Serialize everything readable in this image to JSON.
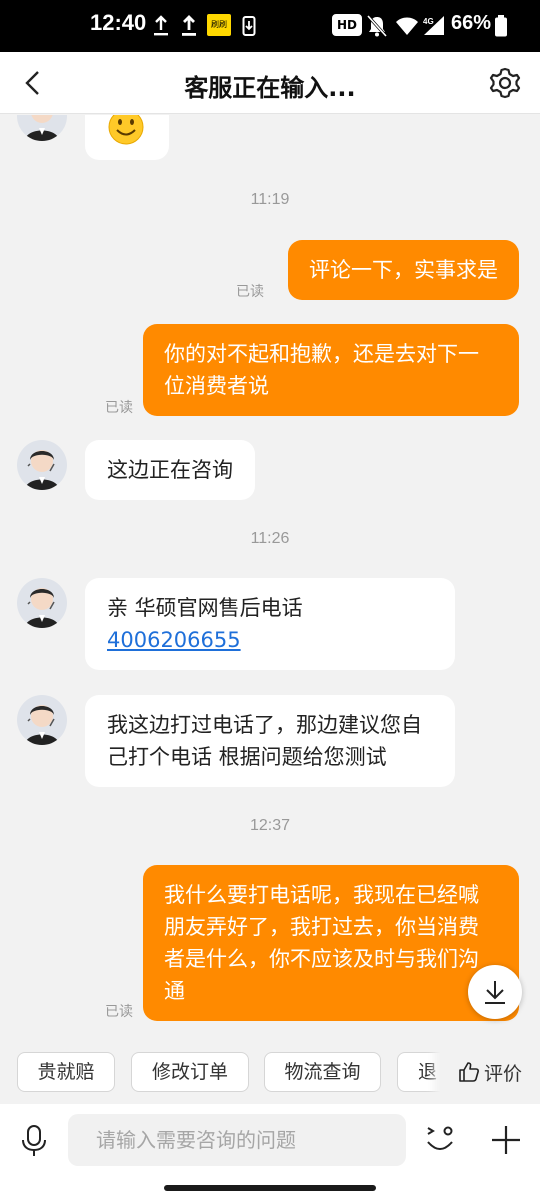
{
  "status_bar": {
    "time": "12:40",
    "hd": "HD",
    "network": "4G",
    "badge": "刷刷",
    "battery": "66%"
  },
  "header": {
    "title": "客服正在输入..."
  },
  "messages": {
    "ts_1": "11:19",
    "out_1": "评论一下，实事求是",
    "out_1_status": "已读",
    "out_2": "你的对不起和抱歉，还是去对下一位消费者说",
    "out_2_status": "已读",
    "in_1": "这边正在咨询",
    "ts_2": "11:26",
    "in_2_text": "亲 华硕官网售后电话",
    "in_2_phone": "4006206655",
    "in_3": "我这边打过电话了，那边建议您自己打个电话 根据问题给您测试",
    "ts_3": "12:37",
    "out_3": "我什么要打电话呢，我现在已经喊朋友弄好了，我打过去，你当消费者是什么，你不应该及时与我们沟通",
    "out_3_status": "已读"
  },
  "quick_actions": {
    "items": [
      "贵就赔",
      "修改订单",
      "物流查询",
      "退"
    ],
    "rate_label": "评价"
  },
  "input_bar": {
    "placeholder": "请输入需要咨询的问题"
  },
  "colors": {
    "accent": "#ff8a00",
    "link": "#1e6fd9",
    "background": "#f2f2f2"
  }
}
